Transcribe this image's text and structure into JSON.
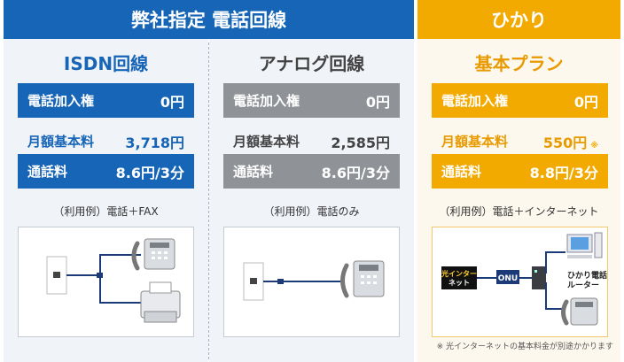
{
  "header": {
    "left_title": "弊社指定 電話回線",
    "right_title": "ひかり"
  },
  "colors": {
    "blue": "#1765b6",
    "gray": "#8f9296",
    "orange": "#f2a900"
  },
  "plans": [
    {
      "title": "ISDN回線",
      "rows": [
        {
          "label": "電話加入権",
          "value": "0円"
        },
        {
          "label": "月額基本料",
          "value": "3,718円"
        },
        {
          "label": "通話料",
          "value": "8.6円/3分"
        }
      ],
      "usage": "（利用例）電話＋FAX"
    },
    {
      "title": "アナログ回線",
      "rows": [
        {
          "label": "電話加入権",
          "value": "0円"
        },
        {
          "label": "月額基本料",
          "value": "2,585円"
        },
        {
          "label": "通話料",
          "value": "8.6円/3分"
        }
      ],
      "usage": "（利用例）電話のみ"
    },
    {
      "title": "基本プラン",
      "rows": [
        {
          "label": "電話加入権",
          "value": "0円"
        },
        {
          "label": "月額基本料",
          "value": "550円",
          "note": "※"
        },
        {
          "label": "通話料",
          "value": "8.8円/3分"
        }
      ],
      "usage": "（利用例）電話＋インターネット",
      "diagram": {
        "net_label_line1": "光インター",
        "net_label_line2": "ネット",
        "onu_label": "ONU",
        "router_label_line1": "ひかり電話",
        "router_label_line2": "ルーター"
      },
      "footnote": "※ 光インターネットの基本料金が別途かかります"
    }
  ]
}
